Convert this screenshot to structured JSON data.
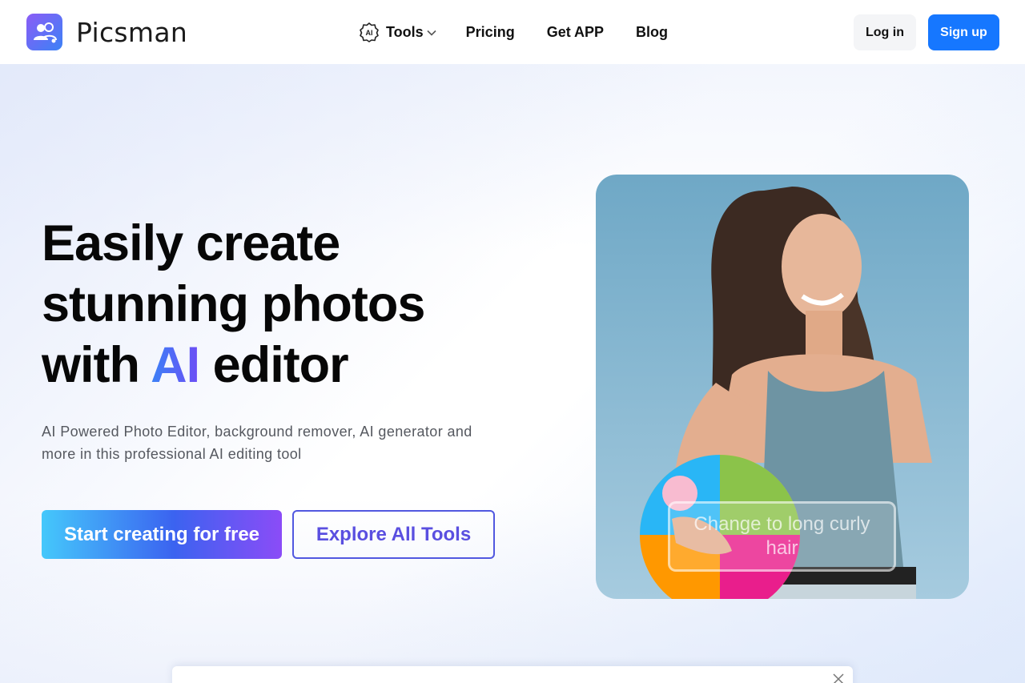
{
  "brand": {
    "name": "Picsman"
  },
  "nav": {
    "tools_label": "Tools",
    "pricing_label": "Pricing",
    "getapp_label": "Get APP",
    "blog_label": "Blog"
  },
  "auth": {
    "login_label": "Log in",
    "signup_label": "Sign up"
  },
  "hero": {
    "headline_line1": "Easily create",
    "headline_line2": "stunning photos",
    "headline_with": "with",
    "headline_ai": "AI",
    "headline_editor": "editor",
    "subtitle": "AI Powered Photo Editor, background remover, AI generator and more in this professional AI editing tool",
    "cta_primary": "Start creating for free",
    "cta_secondary": "Explore All Tools",
    "photo_prompt": "Change to long curly hair"
  },
  "icons": {
    "ai_icon_text": "AI"
  },
  "colors": {
    "signup": "#1677ff",
    "explore_border": "#5158e0",
    "ai_gradient_start": "#3b82f6",
    "ai_gradient_end": "#6d4df5"
  }
}
